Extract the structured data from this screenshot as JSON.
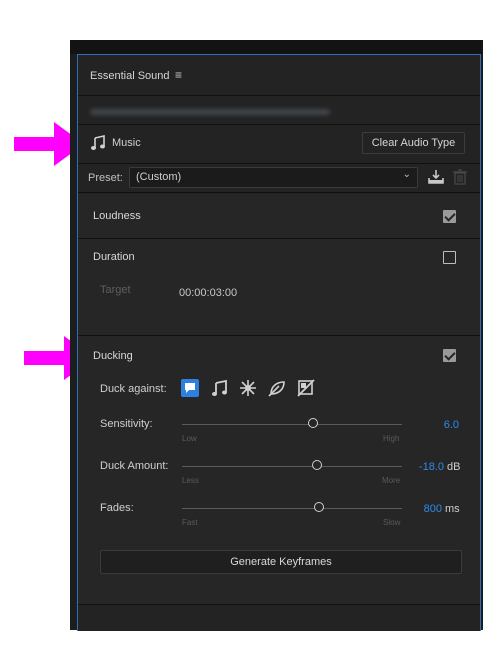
{
  "panel": {
    "title": "Essential Sound",
    "menu_icon": "hamburger-menu-icon"
  },
  "audio_type": {
    "icon": "music-note-icon",
    "label": "Music",
    "clear_button": "Clear Audio Type"
  },
  "preset": {
    "label": "Preset:",
    "value": "(Custom)",
    "save_icon": "save-preset-icon",
    "delete_icon": "trash-icon"
  },
  "loudness": {
    "title": "Loudness",
    "checked": true
  },
  "duration": {
    "title": "Duration",
    "checked": false,
    "target_label": "Target",
    "target_value": "00:00:03:00"
  },
  "ducking": {
    "title": "Ducking",
    "checked": true,
    "duck_against_label": "Duck against:",
    "duck_against_icons": [
      "dialogue-icon",
      "music-icon",
      "sfx-icon",
      "ambience-icon",
      "unassigned-icon"
    ],
    "sensitivity": {
      "label": "Sensitivity:",
      "min_label": "Low",
      "max_label": "High",
      "value": "6.0",
      "unit": "",
      "position": 0.6
    },
    "duck_amount": {
      "label": "Duck Amount:",
      "min_label": "Less",
      "max_label": "More",
      "value": "-18.0",
      "unit": "dB",
      "position": 0.62
    },
    "fades": {
      "label": "Fades:",
      "min_label": "Fast",
      "max_label": "Slow",
      "value": "800",
      "unit": "ms",
      "position": 0.63
    },
    "generate_button": "Generate Keyframes"
  },
  "colors": {
    "accent_blue": "#2d8ceb",
    "annotation_arrow": "#ff00ff",
    "panel_bg": "#232323"
  }
}
